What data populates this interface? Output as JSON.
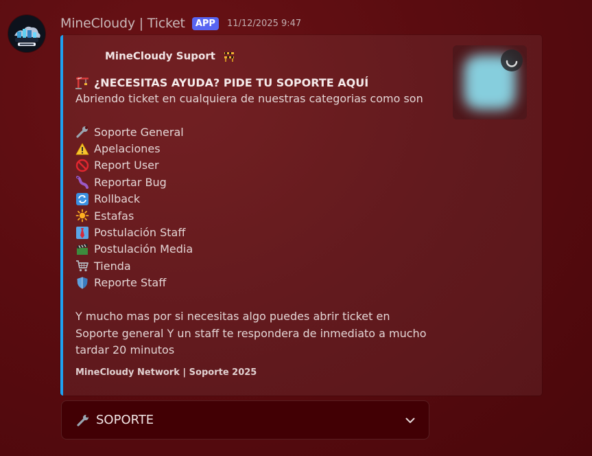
{
  "message": {
    "author": "MineCloudy | Ticket",
    "badge": "APP",
    "timestamp": "11/12/2025 9:47"
  },
  "embed": {
    "author_name": "MineCloudy Suport",
    "title": "¿NECESITAS AYUDA? PIDE TU SOPORTE AQUÍ",
    "description": "Abriendo ticket en cualquiera de nuestras categorias como son",
    "categories": [
      {
        "icon": "wrench-icon",
        "label": "Soporte General"
      },
      {
        "icon": "warning-icon",
        "label": "Apelaciones"
      },
      {
        "icon": "no-entry-icon",
        "label": "Report User"
      },
      {
        "icon": "worm-icon",
        "label": "Reportar Bug"
      },
      {
        "icon": "arrows-cycle-icon",
        "label": "Rollback"
      },
      {
        "icon": "sun-icon",
        "label": "Estafas"
      },
      {
        "icon": "necktie-icon",
        "label": "Postulación Staff"
      },
      {
        "icon": "clapper-board-icon",
        "label": "Postulación Media"
      },
      {
        "icon": "shopping-cart-icon",
        "label": "Tienda"
      },
      {
        "icon": "shield-icon",
        "label": "Reporte Staff"
      }
    ],
    "body_lines": [
      "Y mucho mas por si necesitas algo puedes abrir ticket en",
      "Soporte general Y un staff te respondera de inmediato a mucho",
      "tardar 20 minutos"
    ],
    "footer": "MineCloudy Network | Soporte 2025",
    "accent_color": "#1ea2f2"
  },
  "select_menu": {
    "icon": "wrench-icon",
    "value": "SOPORTE"
  }
}
